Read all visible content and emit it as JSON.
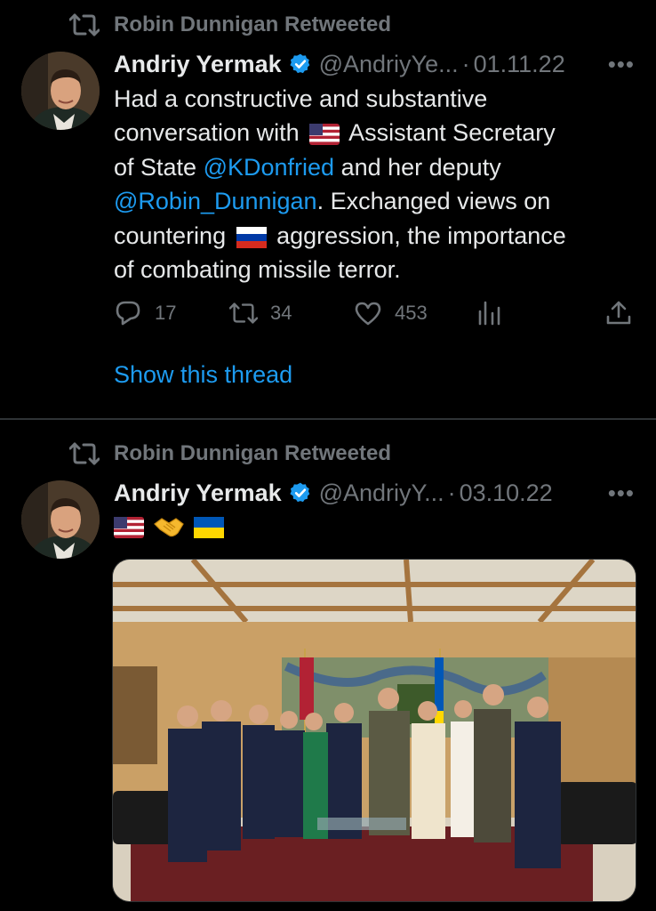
{
  "tweets": [
    {
      "retweeted_by": "Robin Dunnigan Retweeted",
      "author_name": "Andriy Yermak",
      "handle": "@AndriyYe...",
      "separator": "·",
      "date": "01.11.22",
      "more": "•••",
      "text_segments": {
        "l1": "Had a constructive and substantive",
        "l2a": "conversation with",
        "l2b": "Assistant Secretary",
        "l3a": "of State ",
        "mention1": "@KDonfried",
        "l3b": " and her deputy",
        "mention2": "@Robin_Dunnigan",
        "l4b": ". Exchanged views on",
        "l5a": "countering",
        "l5b": "aggression, the importance",
        "l6": "of combating missile terror."
      },
      "flags": [
        "us-flag",
        "ru-flag"
      ],
      "reply_count": "17",
      "retweet_count": "34",
      "like_count": "453",
      "show_thread": "Show this thread"
    },
    {
      "retweeted_by": "Robin Dunnigan Retweeted",
      "author_name": "Andriy Yermak",
      "handle": "@AndriyY...",
      "separator": "·",
      "date": "03.10.22",
      "more": "•••",
      "emojis": [
        "us-flag",
        "handshake",
        "ua-flag"
      ]
    }
  ],
  "icons": [
    "retweet-icon",
    "verified-badge-icon",
    "reply-icon",
    "like-icon",
    "analytics-icon",
    "share-icon"
  ],
  "colors": {
    "background": "#000000",
    "text": "#e7e9ea",
    "muted": "#71767b",
    "accent": "#1d9bf0",
    "divider": "#2f3336"
  }
}
